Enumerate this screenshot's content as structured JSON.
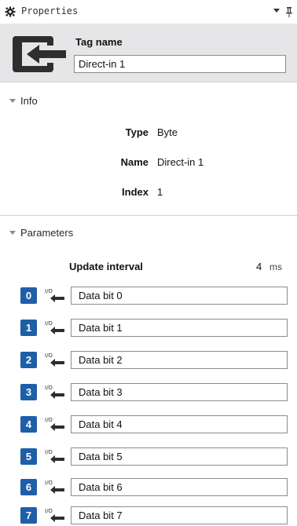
{
  "panel": {
    "title": "Properties",
    "icons": {
      "title_icon": "gear-icon",
      "menu_icon": "dropdown-icon",
      "pin_icon": "pin-icon"
    }
  },
  "header": {
    "icon": "direct-input-icon",
    "tag_label": "Tag name",
    "tag_value": "Direct-in 1"
  },
  "info": {
    "label": "Info",
    "rows": [
      {
        "key": "Type",
        "value": "Byte"
      },
      {
        "key": "Name",
        "value": "Direct-in 1"
      },
      {
        "key": "Index",
        "value": "1"
      }
    ]
  },
  "parameters": {
    "label": "Parameters",
    "update_interval": {
      "label": "Update interval",
      "value": "4",
      "unit": "ms"
    },
    "bits": [
      {
        "index": "0",
        "value": "Data bit 0"
      },
      {
        "index": "1",
        "value": "Data bit 1"
      },
      {
        "index": "2",
        "value": "Data bit 2"
      },
      {
        "index": "3",
        "value": "Data bit 3"
      },
      {
        "index": "4",
        "value": "Data bit 4"
      },
      {
        "index": "5",
        "value": "Data bit 5"
      },
      {
        "index": "6",
        "value": "Data bit 6"
      },
      {
        "index": "7",
        "value": "Data bit 7"
      }
    ],
    "io_icon": "io-input-arrow-icon"
  },
  "colors": {
    "accent": "#1f5fa8",
    "header_bg": "#e6e6e8"
  }
}
